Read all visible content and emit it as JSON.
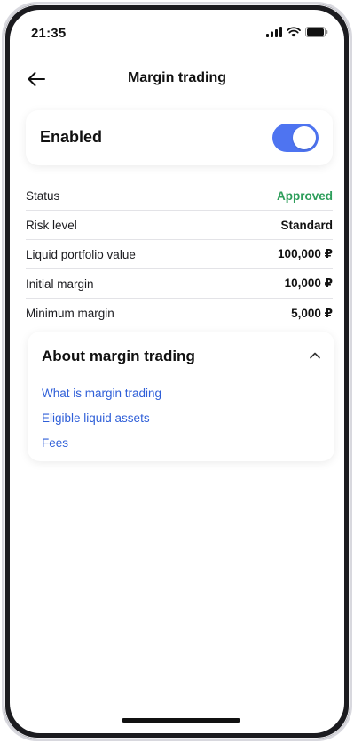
{
  "status_bar": {
    "time": "21:35",
    "icons": [
      "signal-icon",
      "wifi-icon",
      "battery-icon"
    ]
  },
  "header": {
    "title": "Margin trading",
    "back_icon": "arrow-left-icon"
  },
  "toggle": {
    "label": "Enabled",
    "state": true,
    "accent_color": "#4e74f1"
  },
  "details": [
    {
      "label": "Status",
      "value": "Approved",
      "value_color": "#2e9e5b"
    },
    {
      "label": "Risk level",
      "value": "Standard"
    },
    {
      "label": "Liquid portfolio value",
      "value": "100,000 ₽"
    },
    {
      "label": "Initial margin",
      "value": "10,000 ₽"
    },
    {
      "label": "Minimum margin",
      "value": "5,000 ₽"
    }
  ],
  "about": {
    "title": "About margin trading",
    "expanded": true,
    "chevron_icon": "chevron-up-icon",
    "links": [
      {
        "label": "What is margin trading"
      },
      {
        "label": "Eligible liquid assets"
      },
      {
        "label": "Fees"
      }
    ],
    "link_color": "#2f5fd8"
  }
}
